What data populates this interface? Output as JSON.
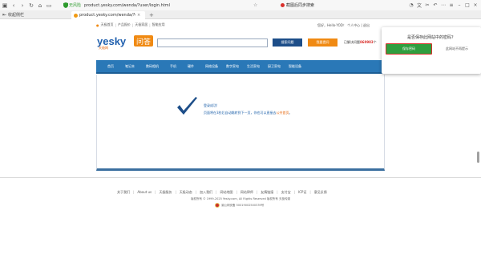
{
  "browser": {
    "security_label": "无风险",
    "url": "product.yesky.com/wenda/?user/login.html",
    "extension_label": "截图后同步搜索",
    "side_collapse_label": "收起侧栏",
    "tab_title": "product.yesky.com/wenda/?use..."
  },
  "site": {
    "topnav": [
      "天极首页",
      "产品报价",
      "天极家居",
      "智能应用"
    ],
    "topright": "您好，Hello·YOD！  个人中心  |  退出",
    "logo_text": "yesky",
    "logo_cn": "天极网",
    "logo_badge": "问答",
    "search_placeholder": "",
    "search_button": "搜索问题",
    "ask_button": "我要提问",
    "solved_prefix": "已解决问题",
    "solved_count": "860983",
    "solved_suffix": "个",
    "nav_items": [
      "首页",
      "笔记本",
      "数码相机",
      "手机",
      "硬件",
      "网络设备",
      "数字家电",
      "生活家电",
      "厨卫家电",
      "智能设备"
    ]
  },
  "result": {
    "line1": "登录成功!",
    "line2_prefix": "页面将在3秒后自动跳转到下一页，你也可以直接去",
    "line2_link": "公共首页",
    "line2_suffix": "。"
  },
  "footer": {
    "links": [
      "关于我们",
      "About us",
      "天极服务",
      "天极动态",
      "加入我们",
      "网站地图",
      "网站律师",
      "友情链接",
      "支付宝",
      "ICP证",
      "意见反馈"
    ],
    "copyright": "版权所有 © 1999-2025 Yesky.com, All Rights Reserved 版权所有 天极传媒",
    "police": "渝公网安备 50019002500339号"
  },
  "popup": {
    "question": "是否保存此网站中的密码？",
    "save_button": "保存密码",
    "never_button": "此网站不再提示"
  }
}
